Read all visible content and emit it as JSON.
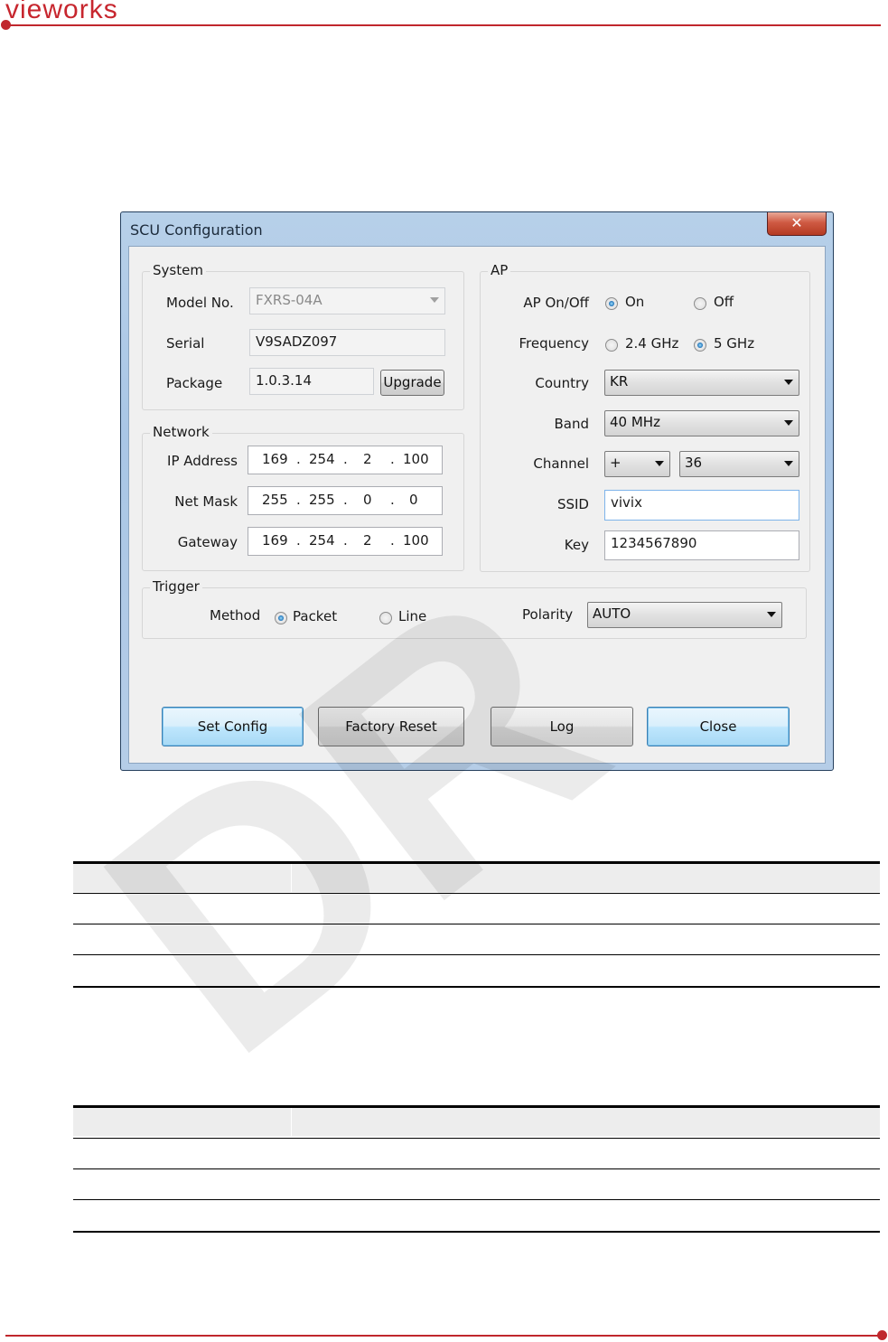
{
  "header": {
    "logo_text": "vieworks"
  },
  "dialog": {
    "title": "SCU Configuration",
    "close_glyph": "✕",
    "system": {
      "group_label": "System",
      "model_label": "Model No.",
      "model_value": "FXRS-04A",
      "serial_label": "Serial",
      "serial_value": "V9SADZ097",
      "package_label": "Package",
      "package_value": "1.0.3.14",
      "upgrade_button": "Upgrade"
    },
    "network": {
      "group_label": "Network",
      "ip_label": "IP Address",
      "ip": [
        "169",
        "254",
        "2",
        "100"
      ],
      "mask_label": "Net Mask",
      "mask": [
        "255",
        "255",
        "0",
        "0"
      ],
      "gateway_label": "Gateway",
      "gateway": [
        "169",
        "254",
        "2",
        "100"
      ],
      "dot": "."
    },
    "ap": {
      "group_label": "AP",
      "onoff_label": "AP On/Off",
      "on_label": "On",
      "off_label": "Off",
      "onoff_selected": "On",
      "frequency_label": "Frequency",
      "freq_24_label": "2.4 GHz",
      "freq_5_label": "5 GHz",
      "frequency_selected": "5 GHz",
      "country_label": "Country",
      "country_value": "KR",
      "band_label": "Band",
      "band_value": "40 MHz",
      "channel_label": "Channel",
      "channel_sign": "+",
      "channel_value": "36",
      "ssid_label": "SSID",
      "ssid_value": "vivix",
      "key_label": "Key",
      "key_value": "1234567890"
    },
    "trigger": {
      "group_label": "Trigger",
      "method_label": "Method",
      "packet_label": "Packet",
      "line_label": "Line",
      "method_selected": "Packet",
      "polarity_label": "Polarity",
      "polarity_value": "AUTO"
    },
    "buttons": {
      "set_config": "Set Config",
      "factory_reset": "Factory Reset",
      "log": "Log",
      "close": "Close"
    }
  },
  "colors": {
    "brand_red": "#c0272d",
    "title_bar": "#a9c6e6",
    "accent_blue": "#3c7fb1"
  }
}
